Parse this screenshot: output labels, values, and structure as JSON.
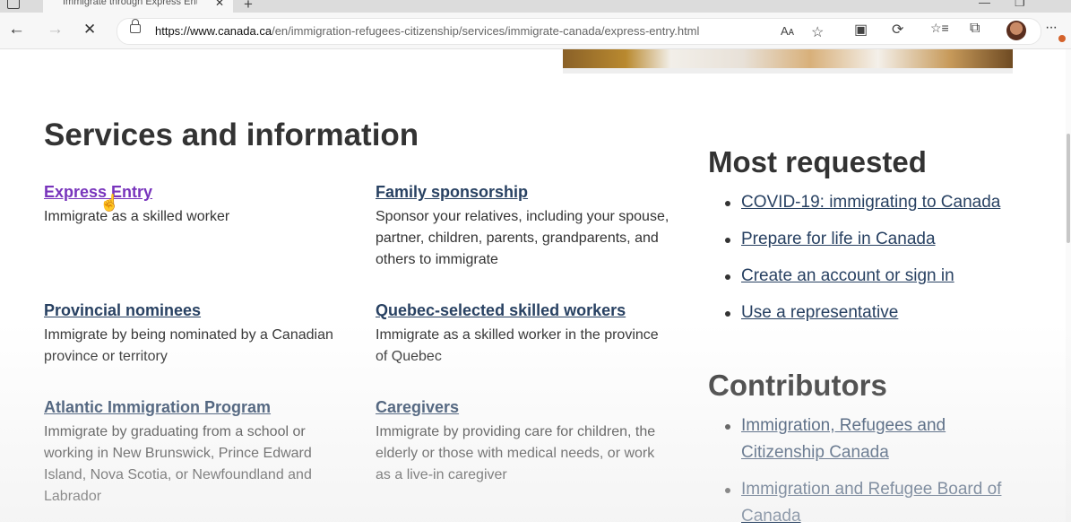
{
  "browser": {
    "tab_title": "Immigrate through Express Entry",
    "tab_close": "✕",
    "new_tab": "+",
    "window_buttons": [
      "—",
      "❐"
    ],
    "url_host": "https://www.canada.ca",
    "url_path": "/en/immigration-refugees-citizenship/services/immigrate-canada/express-entry.html",
    "nav": {
      "back": "←",
      "forward": "→",
      "stop": "✕"
    },
    "toolbar_icons": [
      "Aᴀ",
      "☆",
      "▣",
      "⟳",
      "☆≡",
      "⧉"
    ],
    "more": "···"
  },
  "services": {
    "heading": "Services and information",
    "items": [
      {
        "title": "Express Entry",
        "desc": "Immigrate as a skilled worker"
      },
      {
        "title": "Family sponsorship",
        "desc": "Sponsor your relatives, including your spouse, partner, children, parents, grandparents, and others to immigrate"
      },
      {
        "title": "Provincial nominees",
        "desc": "Immigrate by being nominated by a Canadian province or territory"
      },
      {
        "title": "Quebec-selected skilled workers",
        "desc": "Immigrate as a skilled worker in the province of Quebec"
      },
      {
        "title": "Atlantic Immigration Program",
        "desc": "Immigrate by graduating from a school or working in New Brunswick, Prince Edward Island, Nova Scotia, or Newfoundland and Labrador"
      },
      {
        "title": "Caregivers",
        "desc": "Immigrate by providing care for children, the elderly or those with medical needs, or work as a live-in caregiver"
      }
    ]
  },
  "most_requested": {
    "heading": "Most requested",
    "links": [
      "COVID-19: immigrating to Canada",
      "Prepare for life in Canada",
      "Create an account or sign in",
      "Use a representative"
    ]
  },
  "contributors": {
    "heading": "Contributors",
    "links": [
      "Immigration, Refugees and Citizenship Canada",
      "Immigration and Refugee Board of Canada"
    ]
  },
  "colors": {
    "link": "#284162",
    "visited": "#7834bc",
    "text": "#333333"
  }
}
